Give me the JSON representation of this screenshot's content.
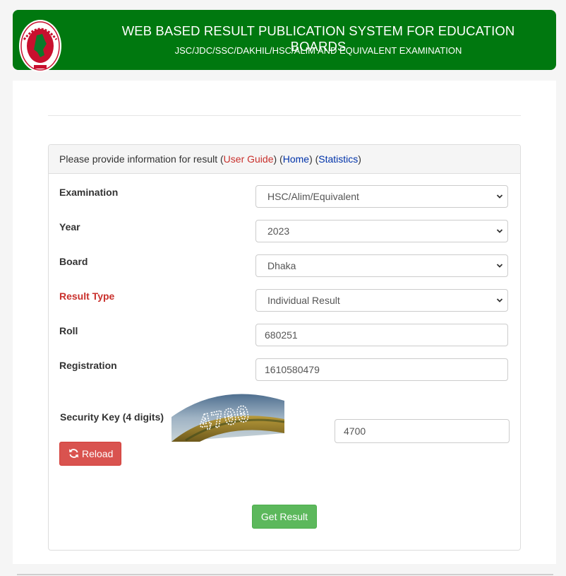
{
  "header": {
    "title": "WEB BASED RESULT PUBLICATION SYSTEM FOR EDUCATION BOARDS",
    "subtitle": "JSC/JDC/SSC/DAKHIL/HSC/ALIM AND EQUIVALENT EXAMINATION"
  },
  "panel": {
    "heading_prefix": "Please provide information for result ",
    "user_guide": "User Guide",
    "home": "Home",
    "statistics": "Statistics"
  },
  "form": {
    "examination": {
      "label": "Examination",
      "value": "HSC/Alim/Equivalent"
    },
    "year": {
      "label": "Year",
      "value": "2023"
    },
    "board": {
      "label": "Board",
      "value": "Dhaka"
    },
    "result_type": {
      "label": "Result Type",
      "value": "Individual Result"
    },
    "roll": {
      "label": "Roll",
      "value": "680251"
    },
    "registration": {
      "label": "Registration",
      "value": "1610580479"
    },
    "security": {
      "label": "Security Key (4 digits)",
      "value": "4700",
      "captcha_text": "4700"
    }
  },
  "buttons": {
    "reload": "Reload",
    "get_result": "Get Result"
  },
  "colors": {
    "header_green": "#00780f",
    "label_red": "#c9302c",
    "link_blue": "#0033aa",
    "reload_red": "#d9534f",
    "submit_green": "#5cb85c"
  },
  "icons": {
    "reload": "refresh-icon",
    "dropdown": "chevron-down-icon",
    "logo": "government-seal-icon"
  }
}
